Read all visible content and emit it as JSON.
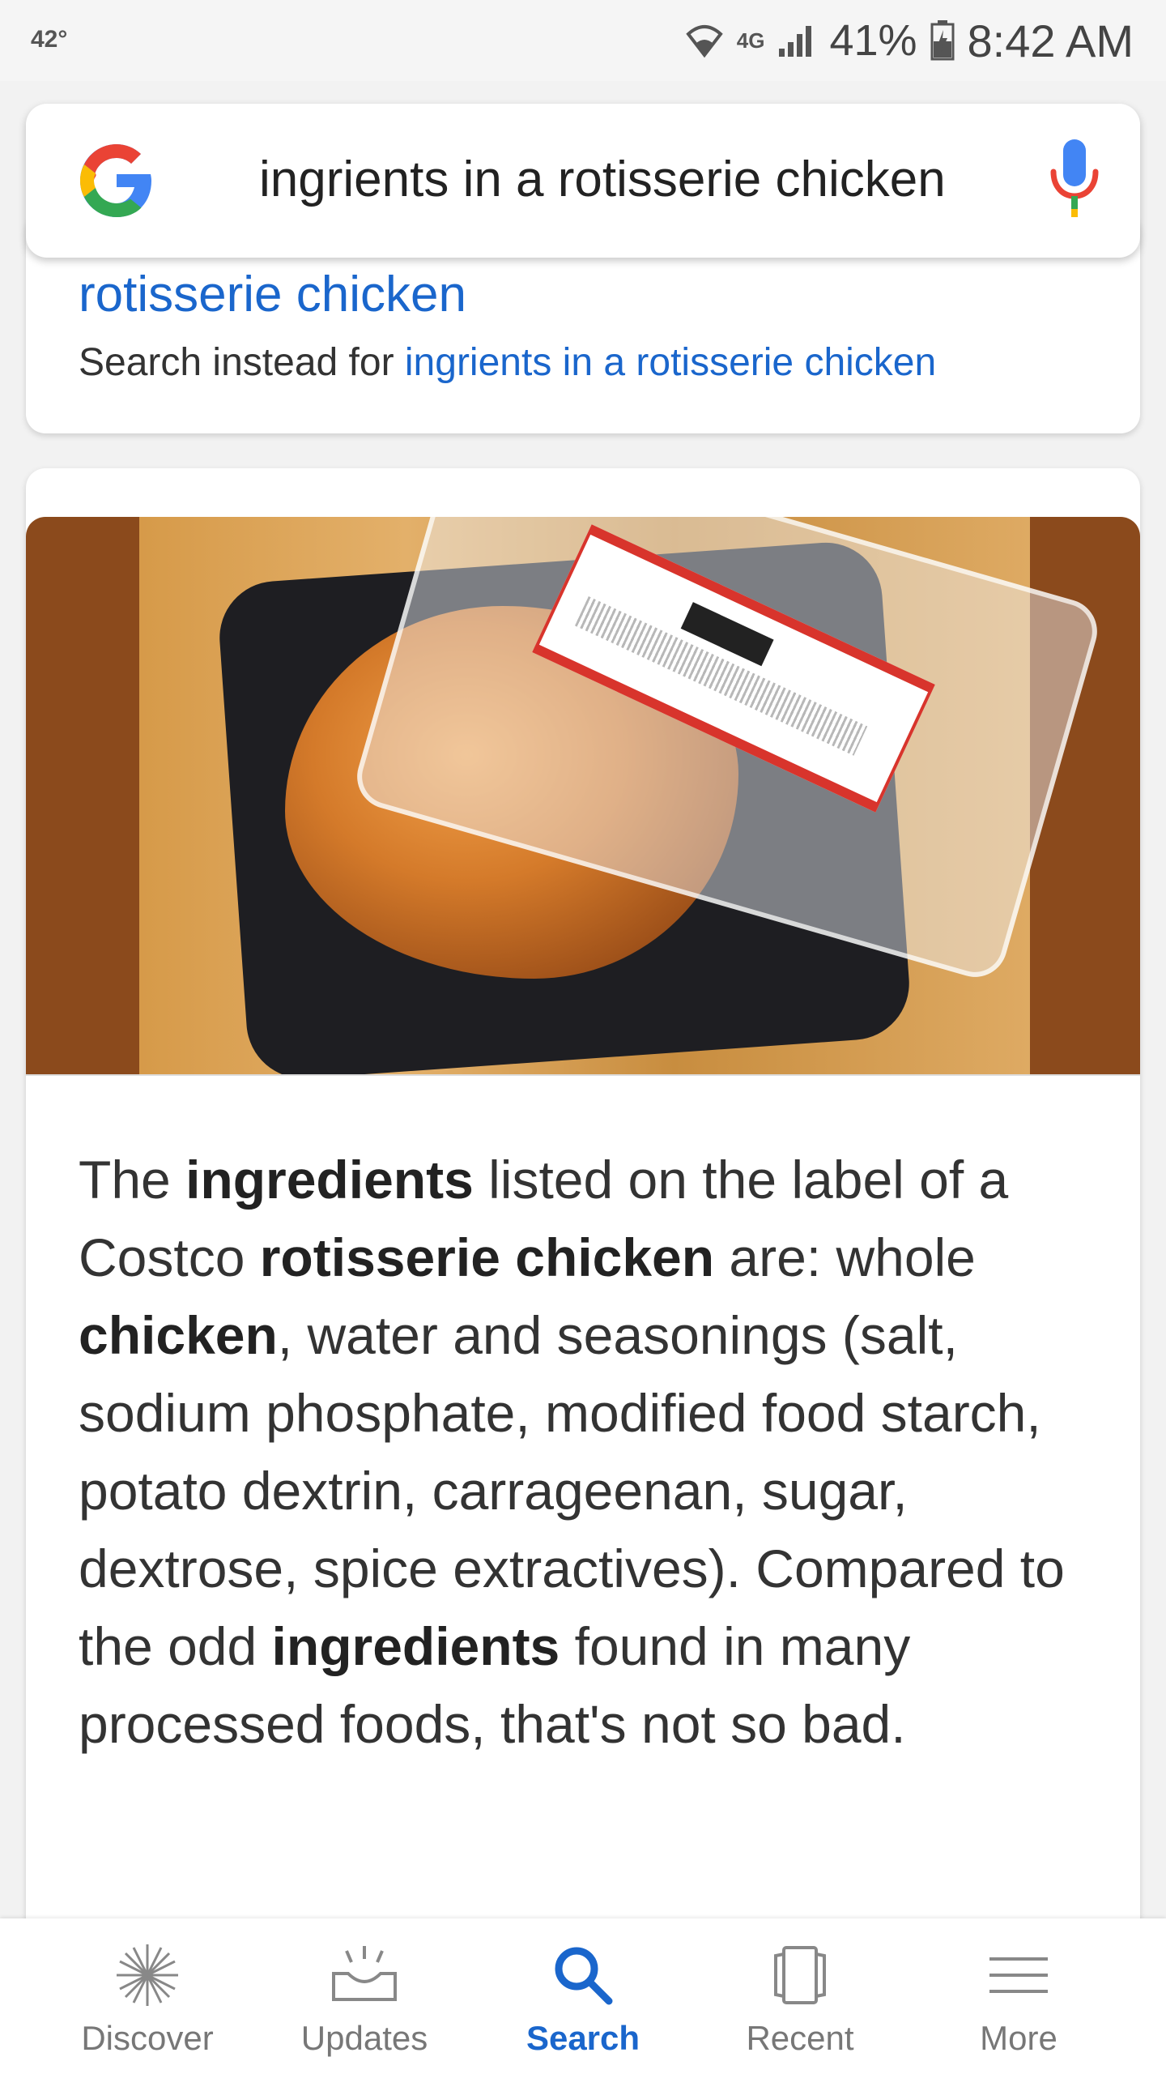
{
  "status_bar": {
    "temperature": "42°",
    "network": "4G",
    "battery_percent": "41%",
    "time": "8:42 AM"
  },
  "search": {
    "query": "ingrients in a rotisserie chicken"
  },
  "correction": {
    "corrected_fragment": "rotisserie chicken",
    "instead_prefix": "Search instead for ",
    "instead_link": "ingrients in a rotisserie chicken"
  },
  "answer": {
    "parts": [
      {
        "t": "The ",
        "b": false
      },
      {
        "t": "ingredients",
        "b": true
      },
      {
        "t": " listed on the label of a Costco ",
        "b": false
      },
      {
        "t": "rotisserie chicken",
        "b": true
      },
      {
        "t": " are: whole ",
        "b": false
      },
      {
        "t": "chicken",
        "b": true
      },
      {
        "t": ", water and seasonings (salt, sodium phosphate, modified food starch, potato dextrin, carrageenan, sugar, dextrose, spice extractives). Compared to the odd ",
        "b": false
      },
      {
        "t": "ingredients",
        "b": true
      },
      {
        "t": " found in many processed foods, that's not so bad.",
        "b": false
      }
    ]
  },
  "bottom_nav": {
    "items": [
      {
        "label": "Discover",
        "icon": "discover-icon",
        "active": false
      },
      {
        "label": "Updates",
        "icon": "updates-icon",
        "active": false
      },
      {
        "label": "Search",
        "icon": "search-icon",
        "active": true
      },
      {
        "label": "Recent",
        "icon": "recent-icon",
        "active": false
      },
      {
        "label": "More",
        "icon": "menu-icon",
        "active": false
      }
    ]
  },
  "colors": {
    "link": "#1a66cc",
    "active_nav": "#1a66cc"
  }
}
